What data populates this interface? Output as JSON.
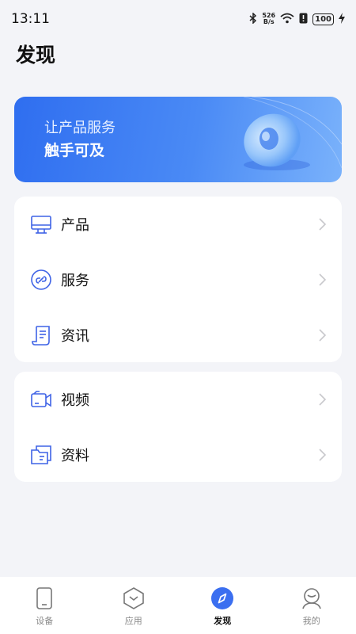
{
  "status_bar": {
    "time": "13:11",
    "net_speed_value": "526",
    "net_speed_unit": "B/s",
    "battery": "100"
  },
  "page": {
    "title": "发现"
  },
  "banner": {
    "line1": "让产品服务",
    "line2": "触手可及"
  },
  "menu_group_1": [
    {
      "label": "产品",
      "icon": "monitor-icon"
    },
    {
      "label": "服务",
      "icon": "service-link-icon"
    },
    {
      "label": "资讯",
      "icon": "news-document-icon"
    }
  ],
  "menu_group_2": [
    {
      "label": "视频",
      "icon": "video-camera-icon"
    },
    {
      "label": "资料",
      "icon": "folder-document-icon"
    }
  ],
  "tab_bar": {
    "tabs": [
      {
        "label": "设备",
        "icon": "device-phone-icon",
        "active": false
      },
      {
        "label": "应用",
        "icon": "app-hexagon-icon",
        "active": false
      },
      {
        "label": "发现",
        "icon": "compass-icon",
        "active": true
      },
      {
        "label": "我的",
        "icon": "profile-person-icon",
        "active": false
      }
    ]
  },
  "colors": {
    "accent": "#3b6ff0",
    "icon_blue": "#3f63e6",
    "background": "#f3f4f8",
    "banner_start": "#2f6ef0",
    "banner_end": "#7ab2fb"
  }
}
